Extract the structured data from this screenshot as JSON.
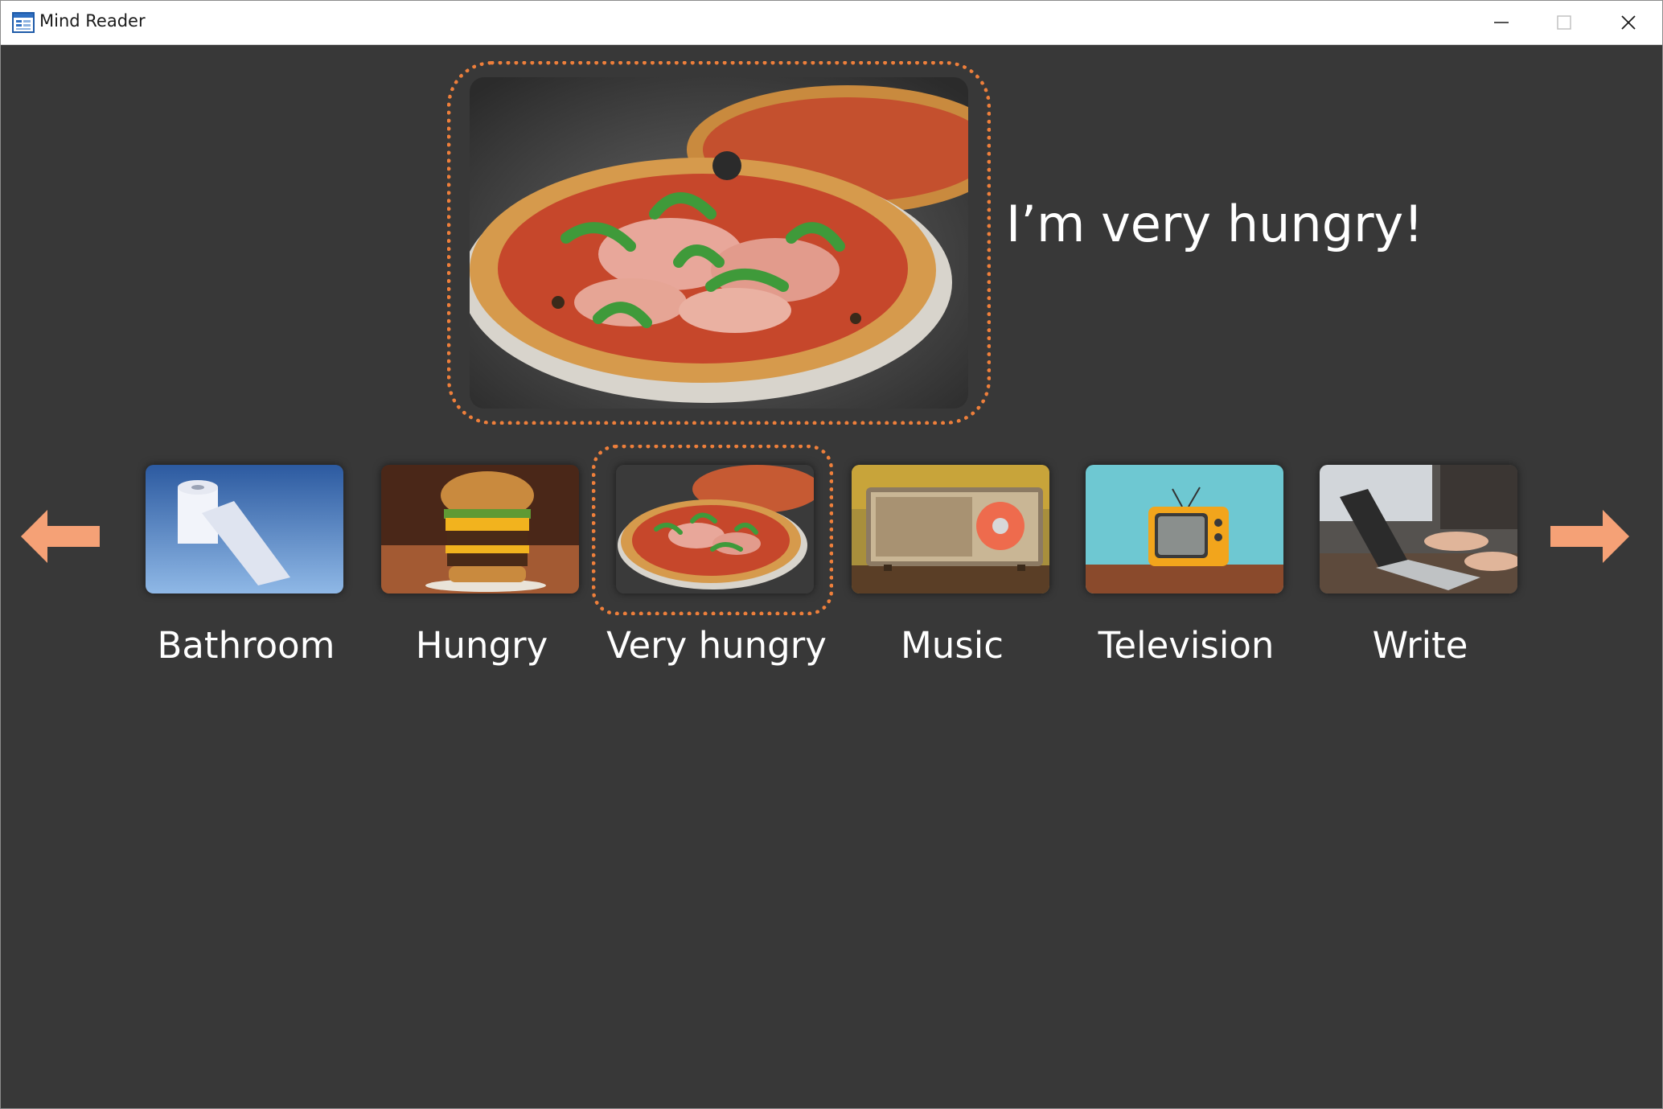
{
  "window": {
    "title": "Mind Reader",
    "controls": {
      "minimize": "minimize",
      "maximize": "maximize",
      "close": "close"
    }
  },
  "hero": {
    "image_icon": "pizza-image",
    "message": "I’m very hungry!"
  },
  "carousel": {
    "prev_icon": "arrow-left-icon",
    "next_icon": "arrow-right-icon",
    "selected_index": 2,
    "accent_color": "#ee7f3b",
    "arrow_color": "#f5a176",
    "items": [
      {
        "label": "Bathroom",
        "image_icon": "toilet-paper-image"
      },
      {
        "label": "Hungry",
        "image_icon": "burger-image"
      },
      {
        "label": "Very hungry",
        "image_icon": "pizza-image"
      },
      {
        "label": "Music",
        "image_icon": "radio-image"
      },
      {
        "label": "Television",
        "image_icon": "television-image"
      },
      {
        "label": "Write",
        "image_icon": "laptop-typing-image"
      }
    ]
  }
}
